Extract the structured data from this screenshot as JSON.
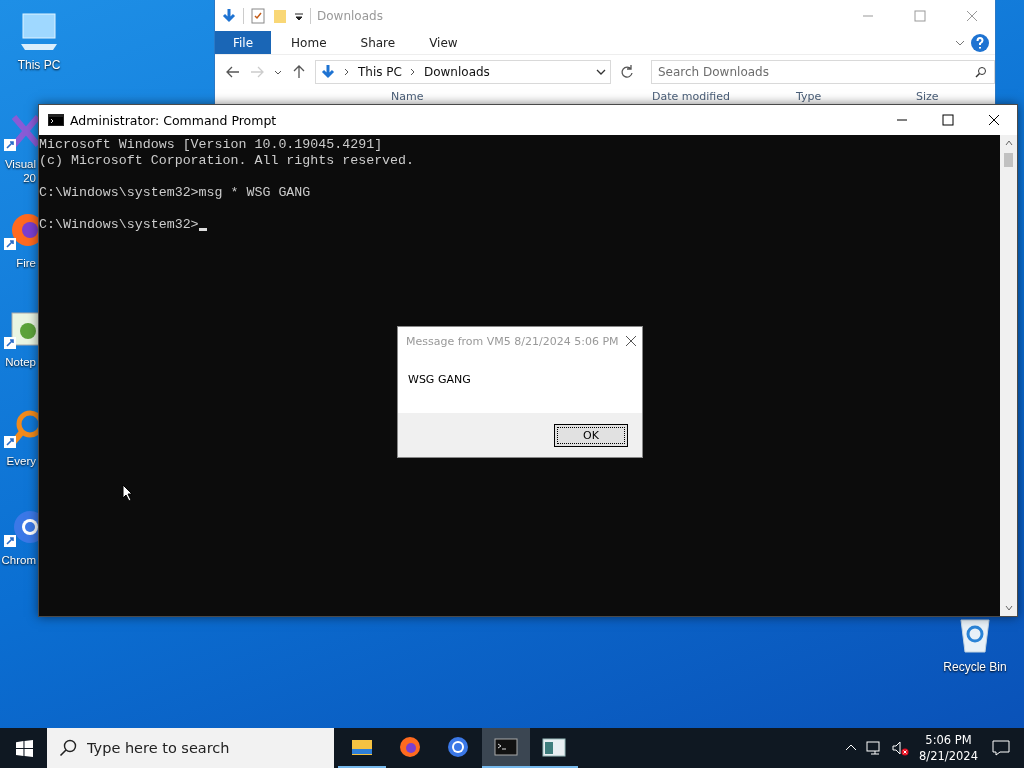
{
  "desktop_icons": [
    {
      "kind": "computer",
      "lines": [
        "This PC"
      ]
    },
    {
      "kind": "visual-studio",
      "lines": [
        "Visual",
        "20"
      ]
    },
    {
      "kind": "firefox",
      "lines": [
        "Fire"
      ]
    },
    {
      "kind": "notepad",
      "lines": [
        "Notep"
      ]
    },
    {
      "kind": "everything",
      "lines": [
        "Every"
      ]
    },
    {
      "kind": "chrome",
      "lines": [
        "Chrom"
      ]
    }
  ],
  "recycle_bin": {
    "label": "Recycle Bin"
  },
  "explorer": {
    "title": "Downloads",
    "tabs": [
      {
        "label": "File",
        "selected": true
      },
      {
        "label": "Home",
        "selected": false
      },
      {
        "label": "Share",
        "selected": false
      },
      {
        "label": "View",
        "selected": false
      }
    ],
    "breadcrumb": [
      "This PC",
      "Downloads"
    ],
    "search": {
      "placeholder": "Search Downloads"
    },
    "columns": [
      "Name",
      "Date modified",
      "Type",
      "Size"
    ]
  },
  "cmd": {
    "title": "Administrator: Command Prompt",
    "lines": [
      {
        "text": "Microsoft Windows [Version 10.0.19045.4291]",
        "gap_before": false
      },
      {
        "text": "(c) Microsoft Corporation. All rights reserved.",
        "gap_before": false
      },
      {
        "text": "C:\\Windows\\system32>msg * WSG GANG",
        "gap_before": true
      },
      {
        "text": "C:\\Windows\\system32>",
        "gap_before": true
      }
    ]
  },
  "dialog": {
    "title": "Message from VM5 8/21/2024 5:06 PM",
    "message": "WSG GANG",
    "button": "OK"
  },
  "taskbar": {
    "search": {
      "placeholder": "Type here to search"
    },
    "apps": [
      {
        "kind": "explorer",
        "running": true,
        "selected": false
      },
      {
        "kind": "firefox",
        "running": false,
        "selected": false
      },
      {
        "kind": "chrome",
        "running": false,
        "selected": false
      },
      {
        "kind": "terminal",
        "running": true,
        "selected": true
      },
      {
        "kind": "app-window",
        "running": true,
        "selected": false
      }
    ],
    "time": "5:06 PM",
    "date": "8/21/2024"
  }
}
